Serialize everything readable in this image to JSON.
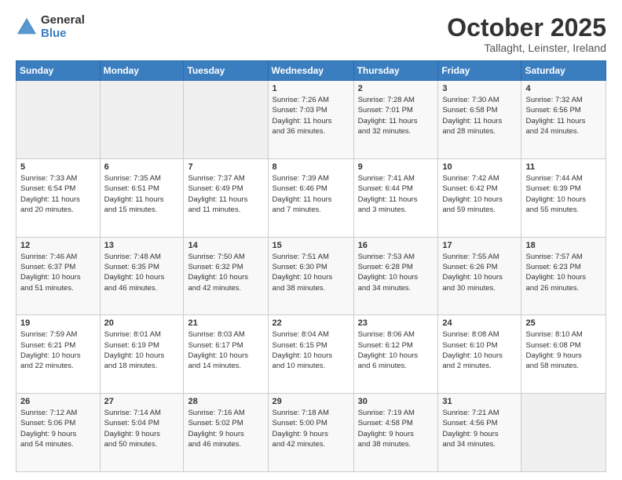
{
  "logo": {
    "general": "General",
    "blue": "Blue"
  },
  "header": {
    "month": "October 2025",
    "location": "Tallaght, Leinster, Ireland"
  },
  "days_of_week": [
    "Sunday",
    "Monday",
    "Tuesday",
    "Wednesday",
    "Thursday",
    "Friday",
    "Saturday"
  ],
  "weeks": [
    [
      {
        "day": "",
        "content": ""
      },
      {
        "day": "",
        "content": ""
      },
      {
        "day": "",
        "content": ""
      },
      {
        "day": "1",
        "content": "Sunrise: 7:26 AM\nSunset: 7:03 PM\nDaylight: 11 hours\nand 36 minutes."
      },
      {
        "day": "2",
        "content": "Sunrise: 7:28 AM\nSunset: 7:01 PM\nDaylight: 11 hours\nand 32 minutes."
      },
      {
        "day": "3",
        "content": "Sunrise: 7:30 AM\nSunset: 6:58 PM\nDaylight: 11 hours\nand 28 minutes."
      },
      {
        "day": "4",
        "content": "Sunrise: 7:32 AM\nSunset: 6:56 PM\nDaylight: 11 hours\nand 24 minutes."
      }
    ],
    [
      {
        "day": "5",
        "content": "Sunrise: 7:33 AM\nSunset: 6:54 PM\nDaylight: 11 hours\nand 20 minutes."
      },
      {
        "day": "6",
        "content": "Sunrise: 7:35 AM\nSunset: 6:51 PM\nDaylight: 11 hours\nand 15 minutes."
      },
      {
        "day": "7",
        "content": "Sunrise: 7:37 AM\nSunset: 6:49 PM\nDaylight: 11 hours\nand 11 minutes."
      },
      {
        "day": "8",
        "content": "Sunrise: 7:39 AM\nSunset: 6:46 PM\nDaylight: 11 hours\nand 7 minutes."
      },
      {
        "day": "9",
        "content": "Sunrise: 7:41 AM\nSunset: 6:44 PM\nDaylight: 11 hours\nand 3 minutes."
      },
      {
        "day": "10",
        "content": "Sunrise: 7:42 AM\nSunset: 6:42 PM\nDaylight: 10 hours\nand 59 minutes."
      },
      {
        "day": "11",
        "content": "Sunrise: 7:44 AM\nSunset: 6:39 PM\nDaylight: 10 hours\nand 55 minutes."
      }
    ],
    [
      {
        "day": "12",
        "content": "Sunrise: 7:46 AM\nSunset: 6:37 PM\nDaylight: 10 hours\nand 51 minutes."
      },
      {
        "day": "13",
        "content": "Sunrise: 7:48 AM\nSunset: 6:35 PM\nDaylight: 10 hours\nand 46 minutes."
      },
      {
        "day": "14",
        "content": "Sunrise: 7:50 AM\nSunset: 6:32 PM\nDaylight: 10 hours\nand 42 minutes."
      },
      {
        "day": "15",
        "content": "Sunrise: 7:51 AM\nSunset: 6:30 PM\nDaylight: 10 hours\nand 38 minutes."
      },
      {
        "day": "16",
        "content": "Sunrise: 7:53 AM\nSunset: 6:28 PM\nDaylight: 10 hours\nand 34 minutes."
      },
      {
        "day": "17",
        "content": "Sunrise: 7:55 AM\nSunset: 6:26 PM\nDaylight: 10 hours\nand 30 minutes."
      },
      {
        "day": "18",
        "content": "Sunrise: 7:57 AM\nSunset: 6:23 PM\nDaylight: 10 hours\nand 26 minutes."
      }
    ],
    [
      {
        "day": "19",
        "content": "Sunrise: 7:59 AM\nSunset: 6:21 PM\nDaylight: 10 hours\nand 22 minutes."
      },
      {
        "day": "20",
        "content": "Sunrise: 8:01 AM\nSunset: 6:19 PM\nDaylight: 10 hours\nand 18 minutes."
      },
      {
        "day": "21",
        "content": "Sunrise: 8:03 AM\nSunset: 6:17 PM\nDaylight: 10 hours\nand 14 minutes."
      },
      {
        "day": "22",
        "content": "Sunrise: 8:04 AM\nSunset: 6:15 PM\nDaylight: 10 hours\nand 10 minutes."
      },
      {
        "day": "23",
        "content": "Sunrise: 8:06 AM\nSunset: 6:12 PM\nDaylight: 10 hours\nand 6 minutes."
      },
      {
        "day": "24",
        "content": "Sunrise: 8:08 AM\nSunset: 6:10 PM\nDaylight: 10 hours\nand 2 minutes."
      },
      {
        "day": "25",
        "content": "Sunrise: 8:10 AM\nSunset: 6:08 PM\nDaylight: 9 hours\nand 58 minutes."
      }
    ],
    [
      {
        "day": "26",
        "content": "Sunrise: 7:12 AM\nSunset: 5:06 PM\nDaylight: 9 hours\nand 54 minutes."
      },
      {
        "day": "27",
        "content": "Sunrise: 7:14 AM\nSunset: 5:04 PM\nDaylight: 9 hours\nand 50 minutes."
      },
      {
        "day": "28",
        "content": "Sunrise: 7:16 AM\nSunset: 5:02 PM\nDaylight: 9 hours\nand 46 minutes."
      },
      {
        "day": "29",
        "content": "Sunrise: 7:18 AM\nSunset: 5:00 PM\nDaylight: 9 hours\nand 42 minutes."
      },
      {
        "day": "30",
        "content": "Sunrise: 7:19 AM\nSunset: 4:58 PM\nDaylight: 9 hours\nand 38 minutes."
      },
      {
        "day": "31",
        "content": "Sunrise: 7:21 AM\nSunset: 4:56 PM\nDaylight: 9 hours\nand 34 minutes."
      },
      {
        "day": "",
        "content": ""
      }
    ]
  ]
}
